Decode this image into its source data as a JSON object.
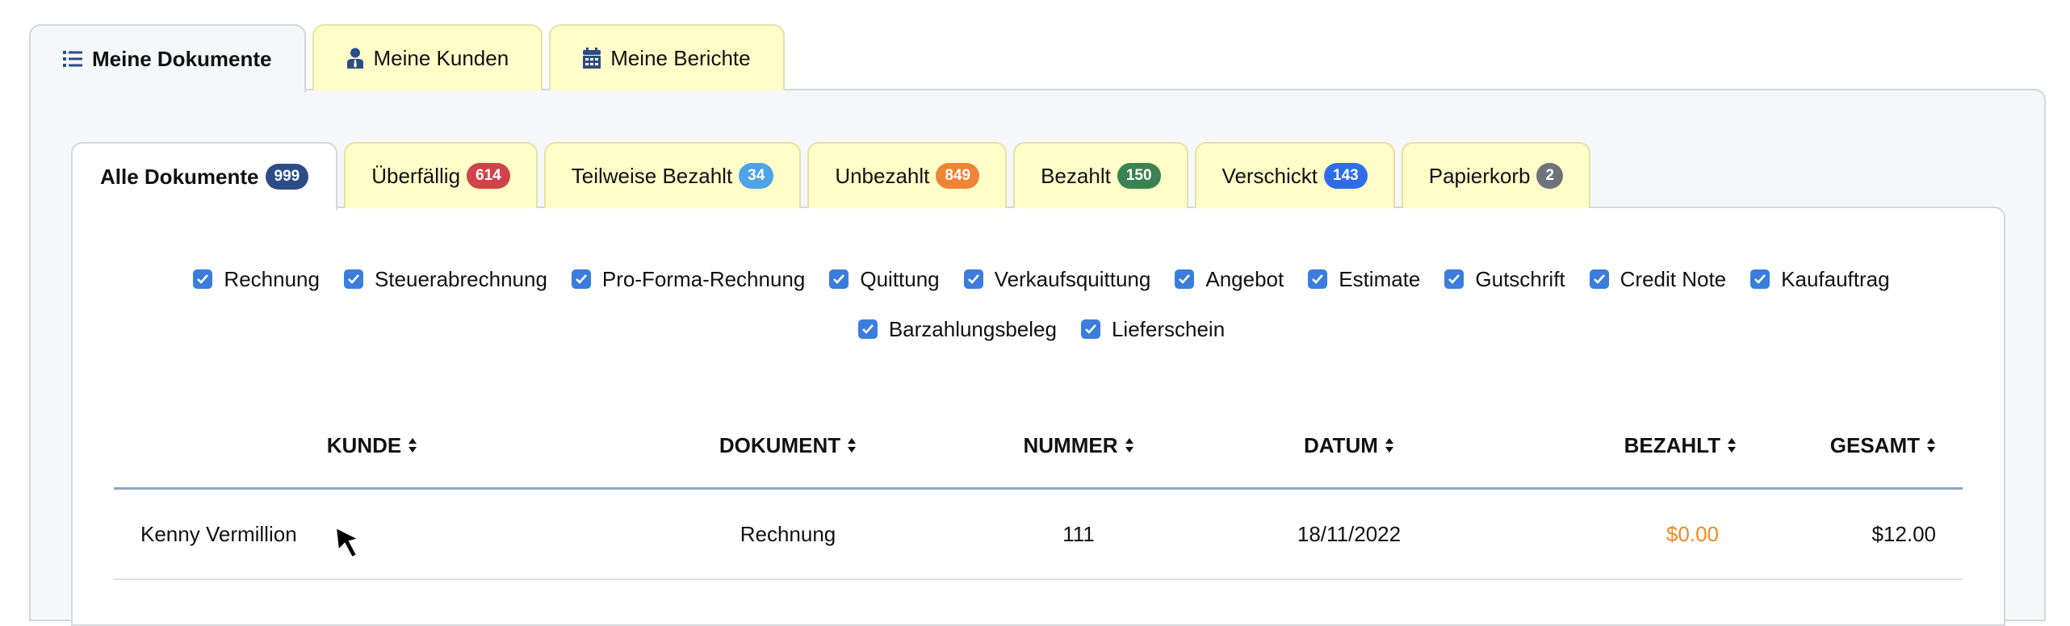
{
  "outer_tabs": [
    {
      "label": "Meine Dokumente",
      "icon": "list-icon",
      "active": true
    },
    {
      "label": "Meine Kunden",
      "icon": "user-tie-icon",
      "active": false
    },
    {
      "label": "Meine Berichte",
      "icon": "calendar-icon",
      "active": false
    }
  ],
  "doc_tabs": [
    {
      "label": "Alle Dokumente",
      "count": "999",
      "color": "#2c4c87",
      "active": true
    },
    {
      "label": "Überfällig",
      "count": "614",
      "color": "#d0434b",
      "active": false
    },
    {
      "label": "Teilweise Bezahlt",
      "count": "34",
      "color": "#4fa3e8",
      "active": false
    },
    {
      "label": "Unbezahlt",
      "count": "849",
      "color": "#ee8435",
      "active": false
    },
    {
      "label": "Bezahlt",
      "count": "150",
      "color": "#3c8152",
      "active": false
    },
    {
      "label": "Verschickt",
      "count": "143",
      "color": "#2f6de8",
      "active": false
    },
    {
      "label": "Papierkorb",
      "count": "2",
      "color": "#6c737b",
      "active": false
    }
  ],
  "filters": [
    {
      "label": "Rechnung",
      "checked": true
    },
    {
      "label": "Steuerabrechnung",
      "checked": true
    },
    {
      "label": "Pro-Forma-Rechnung",
      "checked": true
    },
    {
      "label": "Quittung",
      "checked": true
    },
    {
      "label": "Verkaufsquittung",
      "checked": true
    },
    {
      "label": "Angebot",
      "checked": true
    },
    {
      "label": "Estimate",
      "checked": true
    },
    {
      "label": "Gutschrift",
      "checked": true
    },
    {
      "label": "Credit Note",
      "checked": true
    },
    {
      "label": "Kaufauftrag",
      "checked": true
    },
    {
      "label": "Barzahlungsbeleg",
      "checked": true
    },
    {
      "label": "Lieferschein",
      "checked": true
    }
  ],
  "table": {
    "columns": [
      "KUNDE",
      "DOKUMENT",
      "NUMMER",
      "DATUM",
      "BEZAHLT",
      "GESAMT"
    ],
    "rows": [
      {
        "kunde": "Kenny Vermillion",
        "dokument": "Rechnung",
        "nummer": "111",
        "datum": "18/11/2022",
        "bezahlt": "$0.00",
        "gesamt": "$12.00"
      }
    ]
  },
  "colors": {
    "icon_blue": "#2c4c87",
    "checkbox_blue": "#3b7ddd",
    "paid_orange": "#f08a24",
    "tab_yellow": "#fffdc8"
  }
}
